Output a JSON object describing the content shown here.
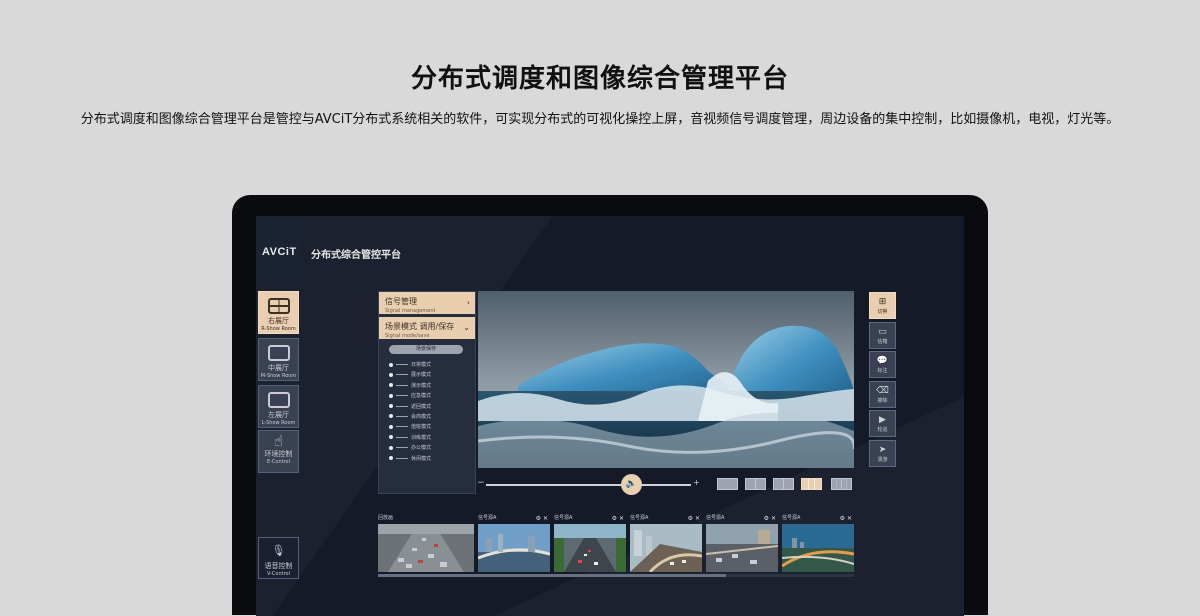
{
  "header": {
    "title": "分布式调度和图像综合管理平台",
    "description": "分布式调度和图像综合管理平台是管控与AVCiT分布式系统相关的软件，可实现分布式的可视化操控上屏，音视频信号调度管理，周边设备的集中控制，比如摄像机，电视，灯光等。"
  },
  "app": {
    "logo": "AVCiT",
    "title": "分布式综合管控平台"
  },
  "nav": [
    {
      "label": "右展厅",
      "sub": "R-Show Room",
      "icon": "screen-grid-icon",
      "active": true
    },
    {
      "label": "中展厅",
      "sub": "M-Show Room",
      "icon": "screen-icon",
      "active": false
    },
    {
      "label": "左展厅",
      "sub": "L-Show Room",
      "icon": "screen-icon",
      "active": false
    },
    {
      "label": "环境控制",
      "sub": "E-Control",
      "icon": "hand-icon",
      "active": false
    }
  ],
  "voice": {
    "label": "语音控制",
    "sub": "V-Control",
    "icon": "microphone-icon"
  },
  "panel": {
    "signal": {
      "label": "信号管理",
      "sub": "Signal management"
    },
    "scene": {
      "label": "场景模式 调用/保存",
      "sub": "Signal mode/save"
    },
    "save_button": "场景保存",
    "scenes": [
      "日常模式",
      "展示模式",
      "演示模式",
      "应急模式",
      "返回模式",
      "会商模式",
      "值班模式",
      "训练模式",
      "办公模式",
      "休闲模式"
    ]
  },
  "slider": {
    "minus": "−",
    "plus": "+",
    "knob_icon": "speaker-icon"
  },
  "right_buttons": [
    {
      "label": "切换",
      "icon": "grid-icon",
      "active": true
    },
    {
      "label": "信箱",
      "icon": "card-icon",
      "active": false
    },
    {
      "label": "标注",
      "icon": "comment-icon",
      "active": false
    },
    {
      "label": "擦除",
      "icon": "eraser-icon",
      "active": false
    },
    {
      "label": "轮巡",
      "icon": "play-icon",
      "active": false
    },
    {
      "label": "漫游",
      "icon": "send-icon",
      "active": false
    }
  ],
  "strip": {
    "items": [
      "回放画",
      "信号源A",
      "信号源A",
      "信号源A",
      "信号源A",
      "信号源A"
    ],
    "controls": "⚙ ✕"
  },
  "colors": {
    "accent": "#e9cfb0",
    "screen_bg": "#141a28",
    "page_bg": "#d9d9d9"
  }
}
